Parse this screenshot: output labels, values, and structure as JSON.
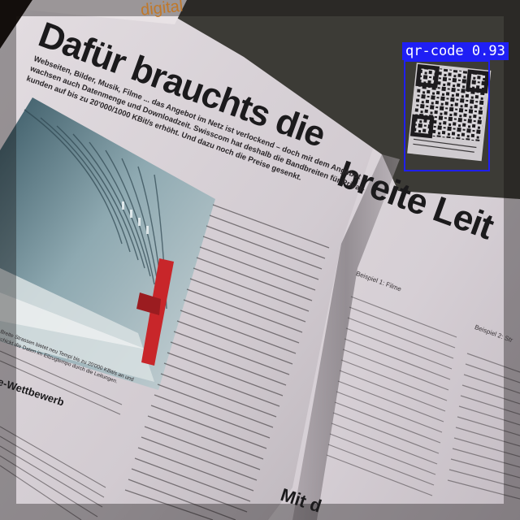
{
  "image": {
    "description": "Photo of an open German magazine spread about broadband internet, with an object-detection box around a QR code"
  },
  "magazine": {
    "section_label": "digital",
    "headline_left": "Dafür brauchts die",
    "headline_right": "breite Leit",
    "lead": [
      "Webseiten, Bilder, Musik, Filme ... das Angebot im Netz ist verlockend – doch mit dem Angebot",
      "wachsen auch Datenmenge und Downloadzeit. Swisscom hat deshalb die Bandbreiten für Privat-",
      "kunden auf bis zu 20'000/1000 KBit/s erhöht. Und dazu noch die Preise gesenkt."
    ],
    "caption": [
      "Breite Strassen bietet neu Tempi bis zu 20'000 KBit/s an und",
      "schickt die Daten im Eilzugtempo durch die Leitungen."
    ],
    "subhead": "e-Wettbewerb",
    "example_label": "Beispiel 1: Filme",
    "example_label_2": "Beispiel 2: Str",
    "bottom_heading": "Mit d"
  },
  "detection": {
    "label": "qr-code",
    "score": "0.93",
    "color": "#1f1ff5"
  },
  "colors": {
    "page": "#d9d2d6",
    "page_shadow": "#a9a2a8",
    "header_band": "#3c3b36",
    "section_label": "#c0782a",
    "red_beam": "#c8262a",
    "ink": "#1b1a1c"
  }
}
